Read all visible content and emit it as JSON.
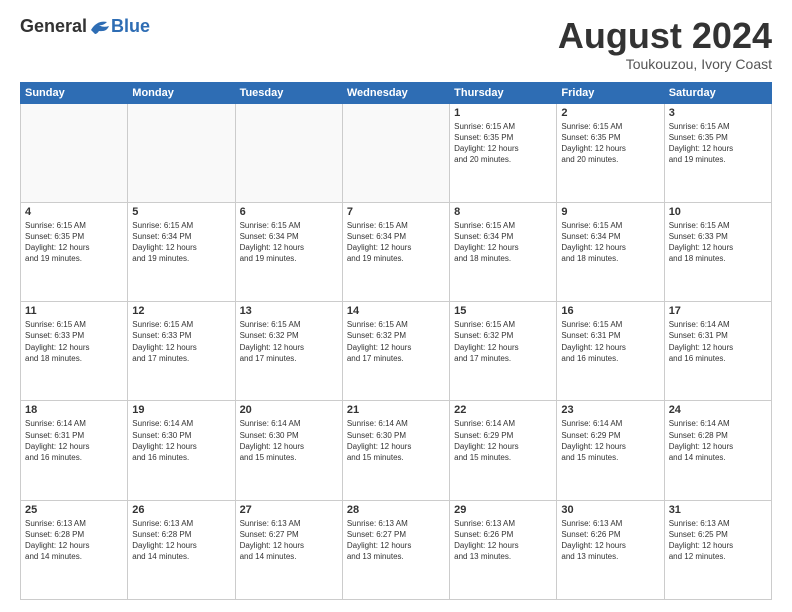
{
  "header": {
    "logo_general": "General",
    "logo_blue": "Blue",
    "month_year": "August 2024",
    "location": "Toukouzou, Ivory Coast"
  },
  "days_of_week": [
    "Sunday",
    "Monday",
    "Tuesday",
    "Wednesday",
    "Thursday",
    "Friday",
    "Saturday"
  ],
  "weeks": [
    [
      {
        "day": "",
        "info": ""
      },
      {
        "day": "",
        "info": ""
      },
      {
        "day": "",
        "info": ""
      },
      {
        "day": "",
        "info": ""
      },
      {
        "day": "1",
        "info": "Sunrise: 6:15 AM\nSunset: 6:35 PM\nDaylight: 12 hours\nand 20 minutes."
      },
      {
        "day": "2",
        "info": "Sunrise: 6:15 AM\nSunset: 6:35 PM\nDaylight: 12 hours\nand 20 minutes."
      },
      {
        "day": "3",
        "info": "Sunrise: 6:15 AM\nSunset: 6:35 PM\nDaylight: 12 hours\nand 19 minutes."
      }
    ],
    [
      {
        "day": "4",
        "info": "Sunrise: 6:15 AM\nSunset: 6:35 PM\nDaylight: 12 hours\nand 19 minutes."
      },
      {
        "day": "5",
        "info": "Sunrise: 6:15 AM\nSunset: 6:34 PM\nDaylight: 12 hours\nand 19 minutes."
      },
      {
        "day": "6",
        "info": "Sunrise: 6:15 AM\nSunset: 6:34 PM\nDaylight: 12 hours\nand 19 minutes."
      },
      {
        "day": "7",
        "info": "Sunrise: 6:15 AM\nSunset: 6:34 PM\nDaylight: 12 hours\nand 19 minutes."
      },
      {
        "day": "8",
        "info": "Sunrise: 6:15 AM\nSunset: 6:34 PM\nDaylight: 12 hours\nand 18 minutes."
      },
      {
        "day": "9",
        "info": "Sunrise: 6:15 AM\nSunset: 6:34 PM\nDaylight: 12 hours\nand 18 minutes."
      },
      {
        "day": "10",
        "info": "Sunrise: 6:15 AM\nSunset: 6:33 PM\nDaylight: 12 hours\nand 18 minutes."
      }
    ],
    [
      {
        "day": "11",
        "info": "Sunrise: 6:15 AM\nSunset: 6:33 PM\nDaylight: 12 hours\nand 18 minutes."
      },
      {
        "day": "12",
        "info": "Sunrise: 6:15 AM\nSunset: 6:33 PM\nDaylight: 12 hours\nand 17 minutes."
      },
      {
        "day": "13",
        "info": "Sunrise: 6:15 AM\nSunset: 6:32 PM\nDaylight: 12 hours\nand 17 minutes."
      },
      {
        "day": "14",
        "info": "Sunrise: 6:15 AM\nSunset: 6:32 PM\nDaylight: 12 hours\nand 17 minutes."
      },
      {
        "day": "15",
        "info": "Sunrise: 6:15 AM\nSunset: 6:32 PM\nDaylight: 12 hours\nand 17 minutes."
      },
      {
        "day": "16",
        "info": "Sunrise: 6:15 AM\nSunset: 6:31 PM\nDaylight: 12 hours\nand 16 minutes."
      },
      {
        "day": "17",
        "info": "Sunrise: 6:14 AM\nSunset: 6:31 PM\nDaylight: 12 hours\nand 16 minutes."
      }
    ],
    [
      {
        "day": "18",
        "info": "Sunrise: 6:14 AM\nSunset: 6:31 PM\nDaylight: 12 hours\nand 16 minutes."
      },
      {
        "day": "19",
        "info": "Sunrise: 6:14 AM\nSunset: 6:30 PM\nDaylight: 12 hours\nand 16 minutes."
      },
      {
        "day": "20",
        "info": "Sunrise: 6:14 AM\nSunset: 6:30 PM\nDaylight: 12 hours\nand 15 minutes."
      },
      {
        "day": "21",
        "info": "Sunrise: 6:14 AM\nSunset: 6:30 PM\nDaylight: 12 hours\nand 15 minutes."
      },
      {
        "day": "22",
        "info": "Sunrise: 6:14 AM\nSunset: 6:29 PM\nDaylight: 12 hours\nand 15 minutes."
      },
      {
        "day": "23",
        "info": "Sunrise: 6:14 AM\nSunset: 6:29 PM\nDaylight: 12 hours\nand 15 minutes."
      },
      {
        "day": "24",
        "info": "Sunrise: 6:14 AM\nSunset: 6:28 PM\nDaylight: 12 hours\nand 14 minutes."
      }
    ],
    [
      {
        "day": "25",
        "info": "Sunrise: 6:13 AM\nSunset: 6:28 PM\nDaylight: 12 hours\nand 14 minutes."
      },
      {
        "day": "26",
        "info": "Sunrise: 6:13 AM\nSunset: 6:28 PM\nDaylight: 12 hours\nand 14 minutes."
      },
      {
        "day": "27",
        "info": "Sunrise: 6:13 AM\nSunset: 6:27 PM\nDaylight: 12 hours\nand 14 minutes."
      },
      {
        "day": "28",
        "info": "Sunrise: 6:13 AM\nSunset: 6:27 PM\nDaylight: 12 hours\nand 13 minutes."
      },
      {
        "day": "29",
        "info": "Sunrise: 6:13 AM\nSunset: 6:26 PM\nDaylight: 12 hours\nand 13 minutes."
      },
      {
        "day": "30",
        "info": "Sunrise: 6:13 AM\nSunset: 6:26 PM\nDaylight: 12 hours\nand 13 minutes."
      },
      {
        "day": "31",
        "info": "Sunrise: 6:13 AM\nSunset: 6:25 PM\nDaylight: 12 hours\nand 12 minutes."
      }
    ]
  ]
}
